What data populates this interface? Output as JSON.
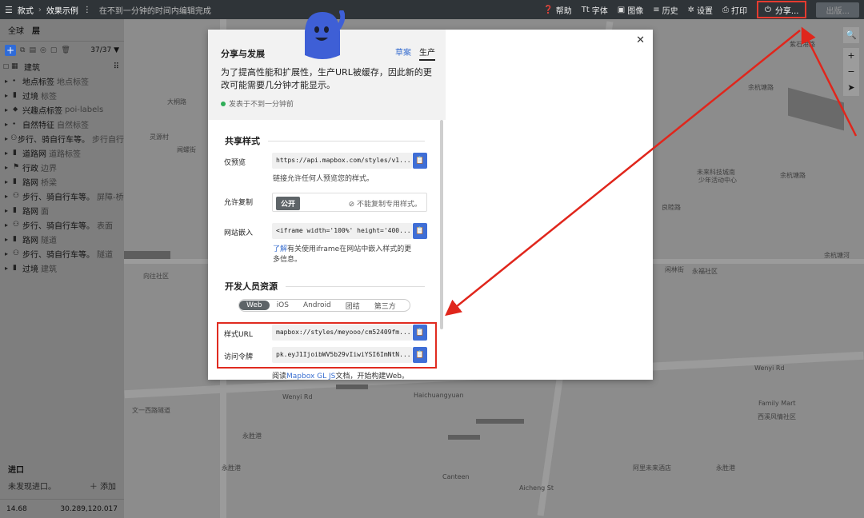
{
  "topbar": {
    "crumb_style": "款式",
    "crumb_example": "效果示例",
    "status": "在不到一分钟的时间内编辑完成",
    "help": "帮助",
    "fonts": "字体",
    "images": "图像",
    "history": "历史",
    "settings": "设置",
    "print": "打印",
    "share": "分享...",
    "publish": "出版..."
  },
  "sidebar": {
    "tab_global": "全球",
    "tab_layers": "层",
    "layer_count": "37/37",
    "layers": [
      {
        "name": "建筑",
        "sub": ""
      },
      {
        "name": "地点标签",
        "sub": "地点标签"
      },
      {
        "name": "过境",
        "sub": "标签"
      },
      {
        "name": "兴趣点标签",
        "sub": "poi-labels"
      },
      {
        "name": "自然特征",
        "sub": "自然标签"
      },
      {
        "name": "步行、骑自行车等。",
        "sub": "步行自行"
      },
      {
        "name": "道路网",
        "sub": "道路标签"
      },
      {
        "name": "行政",
        "sub": "边界"
      },
      {
        "name": "路网",
        "sub": "桥梁"
      },
      {
        "name": "步行、骑自行车等。",
        "sub": "屏障-桥"
      },
      {
        "name": "路网",
        "sub": "面"
      },
      {
        "name": "步行、骑自行车等。",
        "sub": "表面"
      },
      {
        "name": "路网",
        "sub": "隧道"
      },
      {
        "name": "步行、骑自行车等。",
        "sub": "隧道"
      },
      {
        "name": "过境",
        "sub": "建筑"
      }
    ],
    "exports_title": "进口",
    "exports_empty": "未发现进口。",
    "exports_add": "添加",
    "zoom": "14.68",
    "coords": "30.289,120.017"
  },
  "map": {
    "labels": [
      {
        "t": "向往社区"
      },
      {
        "t": "Haichuangyuan"
      },
      {
        "t": "Wenyi Rd"
      },
      {
        "t": "Wenyi Rd"
      },
      {
        "t": "文一西路隧道"
      },
      {
        "t": "永胜港"
      },
      {
        "t": "永胜港"
      },
      {
        "t": "Canteen"
      },
      {
        "t": "阿里未来酒店"
      },
      {
        "t": "永胜港"
      },
      {
        "t": "Aicheng St"
      },
      {
        "t": "Family Mart"
      },
      {
        "t": "西溪风情社区"
      },
      {
        "t": "永福社区"
      },
      {
        "t": "闲林街"
      },
      {
        "t": "余杭塘河"
      },
      {
        "t": "余杭塘路"
      },
      {
        "t": "余杭塘路"
      },
      {
        "t": "未来科技城南"
      },
      {
        "t": "少年活动中心"
      },
      {
        "t": "灵源村"
      },
      {
        "t": "大桐路"
      },
      {
        "t": "紫石港路"
      },
      {
        "t": "闻螺街"
      },
      {
        "t": "良睦路"
      }
    ]
  },
  "modal": {
    "title": "分享与发展",
    "tab_draft": "草案",
    "tab_production": "生产",
    "description": "为了提高性能和扩展性，生产URL被缓存，因此新的更改可能需要几分钟才能显示。",
    "published": "发表于不到一分钟前",
    "share_section": "共享样式",
    "preview_label": "仅预览",
    "preview_url": "https://api.mapbox.com/styles/v1...",
    "preview_help": "链接允许任何人预览您的样式。",
    "copy_label": "允许复制",
    "copy_public": "公开",
    "copy_private": "不能复制专用样式。",
    "embed_label": "网站嵌入",
    "embed_code": "<iframe width='100%' height='400...",
    "embed_help_link": "了解",
    "embed_help_rest": "有关使用iframe在网站中嵌入样式的更多信息。",
    "dev_section": "开发人员资源",
    "platforms": [
      "Web",
      "iOS",
      "Android",
      "团结",
      "第三方"
    ],
    "style_url_label": "样式URL",
    "style_url": "mapbox://styles/meyooo/cm52409fm...",
    "token_label": "访问令牌",
    "token": "pk.eyJ1IjoibWV5b29vIiwiYSI6ImNtN...",
    "read_prefix": "阅读",
    "read_link": "Mapbox GL JS",
    "read_suffix": "文档，开始构建Web。"
  }
}
